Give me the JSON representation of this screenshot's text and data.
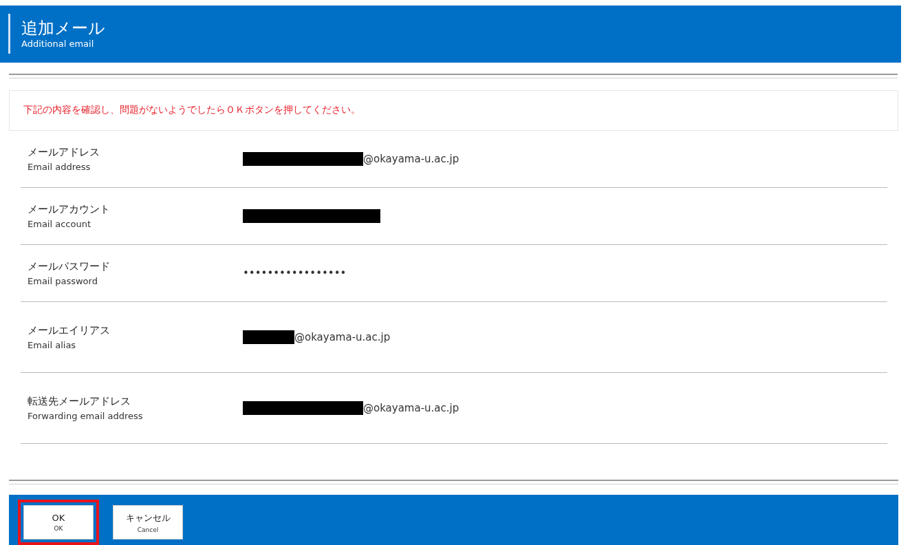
{
  "header": {
    "title": "追加メール",
    "subtitle": "Additional email"
  },
  "message": "下記の内容を確認し、問題がないようでしたらＯＫボタンを押してください。",
  "fields": [
    {
      "label": "メールアドレス",
      "sublabel": "Email address",
      "redacted": true,
      "value": "@okayama-u.ac.jp",
      "tall": false
    },
    {
      "label": "メールアカウント",
      "sublabel": "Email account",
      "redacted": true,
      "tall": false
    },
    {
      "label": "メールパスワード",
      "sublabel": "Email password",
      "redacted": false,
      "value": "•••••••••••••••••",
      "tall": false
    },
    {
      "label": "メールエイリアス",
      "sublabel": "Email alias",
      "redacted": true,
      "value": "@okayama-u.ac.jp",
      "tall": true
    },
    {
      "label": "転送先メールアドレス",
      "sublabel": "Forwarding email address",
      "redacted": true,
      "value": "@okayama-u.ac.jp",
      "tall": true
    }
  ],
  "buttons": [
    {
      "label": "OK",
      "sublabel": "OK",
      "highlighted": true
    },
    {
      "label": "キャンセル",
      "sublabel": "Cancel",
      "highlighted": false
    }
  ]
}
